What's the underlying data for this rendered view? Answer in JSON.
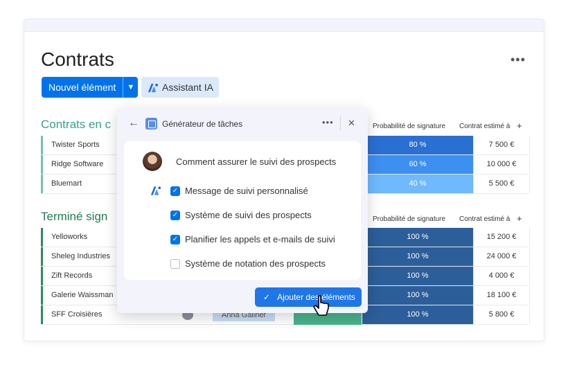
{
  "page": {
    "title": "Contrats"
  },
  "toolbar": {
    "new_item_label": "Nouvel élément",
    "ai_label": "Assistant IA"
  },
  "columns": {
    "probability": "Probabilité de signature",
    "estimate": "Contrat estimé à",
    "add": "+"
  },
  "groups": [
    {
      "title": "Contrats en c",
      "color": "#37a08e",
      "rows": [
        {
          "name": "Twister Sports",
          "probability": "80 %",
          "amount": "7 500 €",
          "prob_color": "#2a6fd2"
        },
        {
          "name": "Ridge Software",
          "probability": "60 %",
          "amount": "10 000 €",
          "prob_color": "#3d8ff0"
        },
        {
          "name": "Bluemart",
          "probability": "40 %",
          "amount": "5 500 €",
          "prob_color": "#6fb9ff"
        }
      ]
    },
    {
      "title": "Terminé sign",
      "color": "#1f7c56",
      "rows": [
        {
          "name": "Yelloworks",
          "probability": "100 %",
          "amount": "15 200 €",
          "prob_color": "#2c5e9a"
        },
        {
          "name": "Sheleg Industries",
          "probability": "100 %",
          "amount": "24 000 €",
          "prob_color": "#2c5e9a"
        },
        {
          "name": "Zift Records",
          "probability": "100 %",
          "amount": "4 000 €",
          "prob_color": "#2c5e9a"
        },
        {
          "name": "Galerie Waissman",
          "probability": "100 %",
          "amount": "18 100 €",
          "prob_color": "#2c5e9a"
        },
        {
          "name": "SFF Croisières",
          "probability": "100 %",
          "amount": "5 800 €",
          "prob_color": "#2c5e9a"
        }
      ]
    }
  ],
  "ghost": {
    "owner": "Anna Gallner"
  },
  "popup": {
    "title": "Générateur de tâches",
    "question": "Comment assurer le suivi des prospects",
    "items": [
      {
        "label": "Message de suivi personnalisé",
        "checked": true
      },
      {
        "label": "Système de suivi des prospects",
        "checked": true
      },
      {
        "label": "Planifier les appels et e-mails de suivi",
        "checked": true
      },
      {
        "label": "Système de notation des prospects",
        "checked": false
      }
    ],
    "add_label": "Ajouter des éléments"
  },
  "colors": {
    "primary": "#0073ea",
    "ai_bg": "#dbe9fb"
  }
}
